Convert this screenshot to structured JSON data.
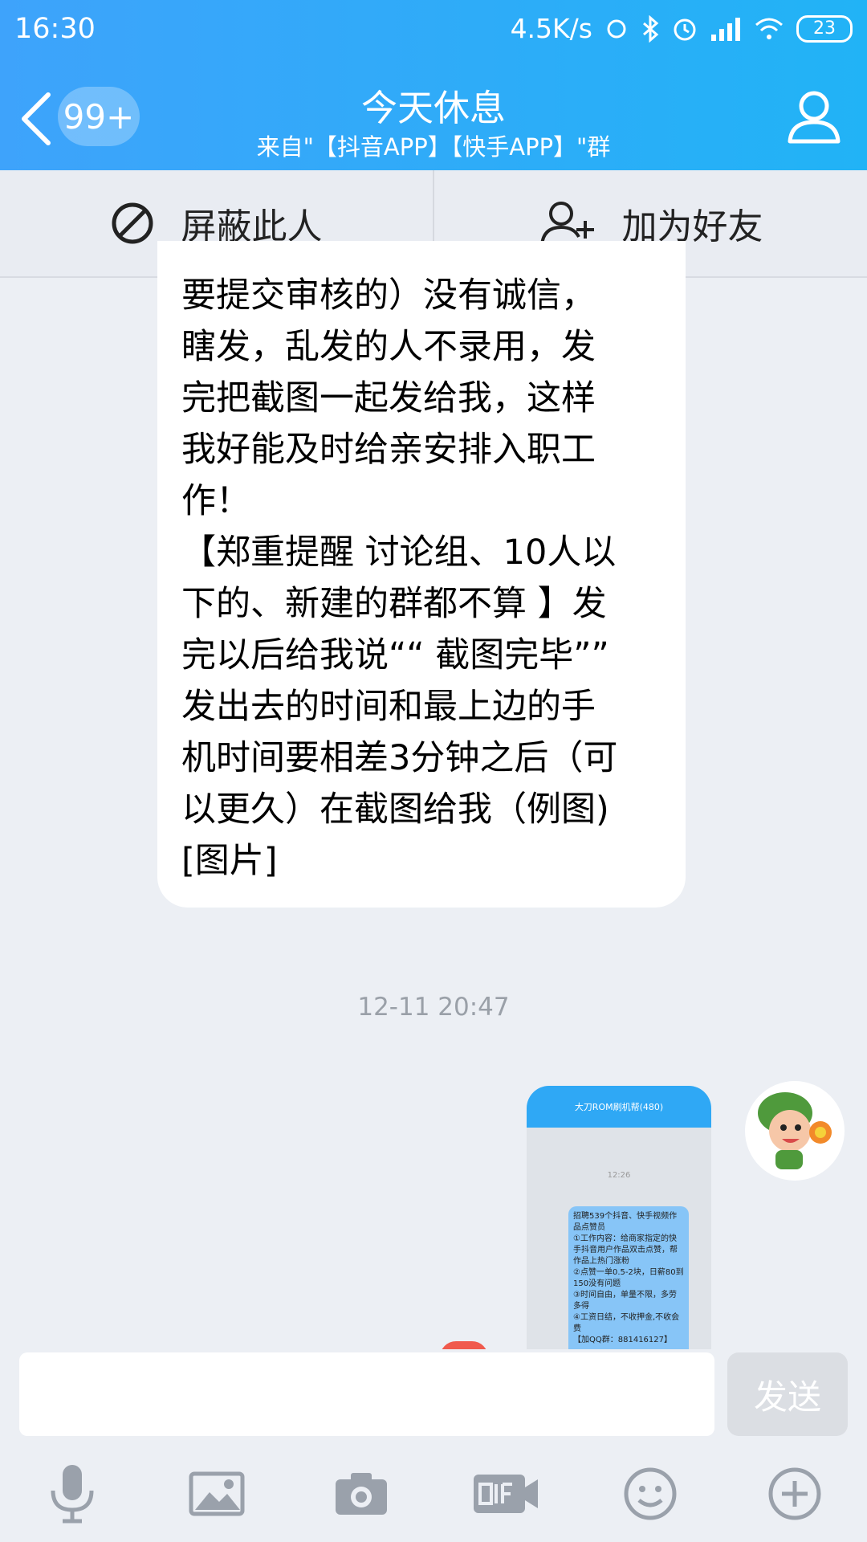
{
  "status_bar": {
    "time": "16:30",
    "network_speed": "4.5K/s",
    "battery": "23"
  },
  "header": {
    "unread_badge": "99+",
    "title": "今天休息",
    "subtitle": "来自\"【抖音APP】【快手APP】\"群"
  },
  "actions": {
    "block_label": "屏蔽此人",
    "add_friend_label": "加为好友"
  },
  "message": {
    "text": "要提交审核的）没有诚信，\n瞎发，乱发的人不录用，发\n完把截图一起发给我，这样\n我好能及时给亲安排入职工\n作！\n【郑重提醒 讨论组、10人以\n下的、新建的群都不算 】发\n完以后给我说““ 截图完毕””\n发出去的时间和最上边的手\n机时间要相差3分钟之后（可\n以更久）在截图给我（例图)\n[图片]"
  },
  "timestamp": "12-11 20:47",
  "thumbnail": {
    "title": "大刀ROM刷机帮(480)",
    "time": "12:26",
    "message": "招聘539个抖音、快手视频作品点赞员\n①工作内容：给商家指定的快手抖音用户作品双击点赞，帮作品上热门涨粉\n②点赞一单0.5-2块，日薪80到150没有问题\n③时间自由，单量不限，多劳多得\n④工资日结，不收押金,不收会费\n【加QQ群：881416127】"
  },
  "input_bar": {
    "send_label": "发送"
  },
  "colors": {
    "header_start": "#3ea3fb",
    "header_end": "#21b3f6",
    "background": "#eceff4"
  }
}
